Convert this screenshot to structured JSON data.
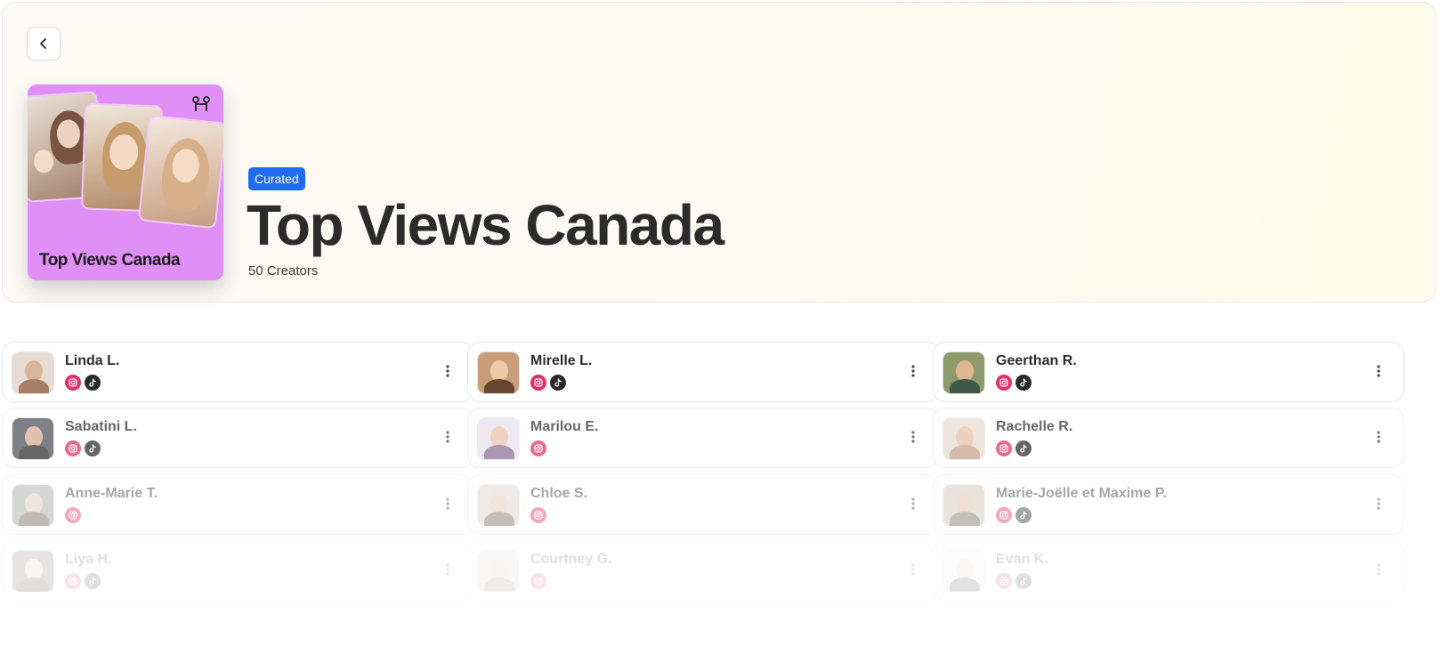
{
  "header": {
    "back_label": "",
    "cover_title": "Top Views Canada",
    "badge": "Curated",
    "title": "Top Views Canada",
    "subtitle": "50 Creators"
  },
  "creators": [
    {
      "name": "Linda L.",
      "instagram": true,
      "tiktok": true
    },
    {
      "name": "Mirelle L.",
      "instagram": true,
      "tiktok": true
    },
    {
      "name": "Geerthan R.",
      "instagram": true,
      "tiktok": true
    },
    {
      "name": "Sabatini L.",
      "instagram": true,
      "tiktok": true
    },
    {
      "name": "Marilou E.",
      "instagram": true,
      "tiktok": false
    },
    {
      "name": "Rachelle R.",
      "instagram": true,
      "tiktok": true
    },
    {
      "name": "Anne-Marie T.",
      "instagram": true,
      "tiktok": false
    },
    {
      "name": "Chloe S.",
      "instagram": true,
      "tiktok": false
    },
    {
      "name": "Marie-Joëlle et Maxime P.",
      "instagram": true,
      "tiktok": true
    },
    {
      "name": "Liya H.",
      "instagram": true,
      "tiktok": true
    },
    {
      "name": "Courtney G.",
      "instagram": true,
      "tiktok": false
    },
    {
      "name": "Evan K.",
      "instagram": true,
      "tiktok": true
    }
  ],
  "colors": {
    "accent_badge": "#1f6cf0",
    "cover_bg": "#df8ff6",
    "instagram": "#e1306c",
    "tiktok": "#2b2b2b"
  }
}
